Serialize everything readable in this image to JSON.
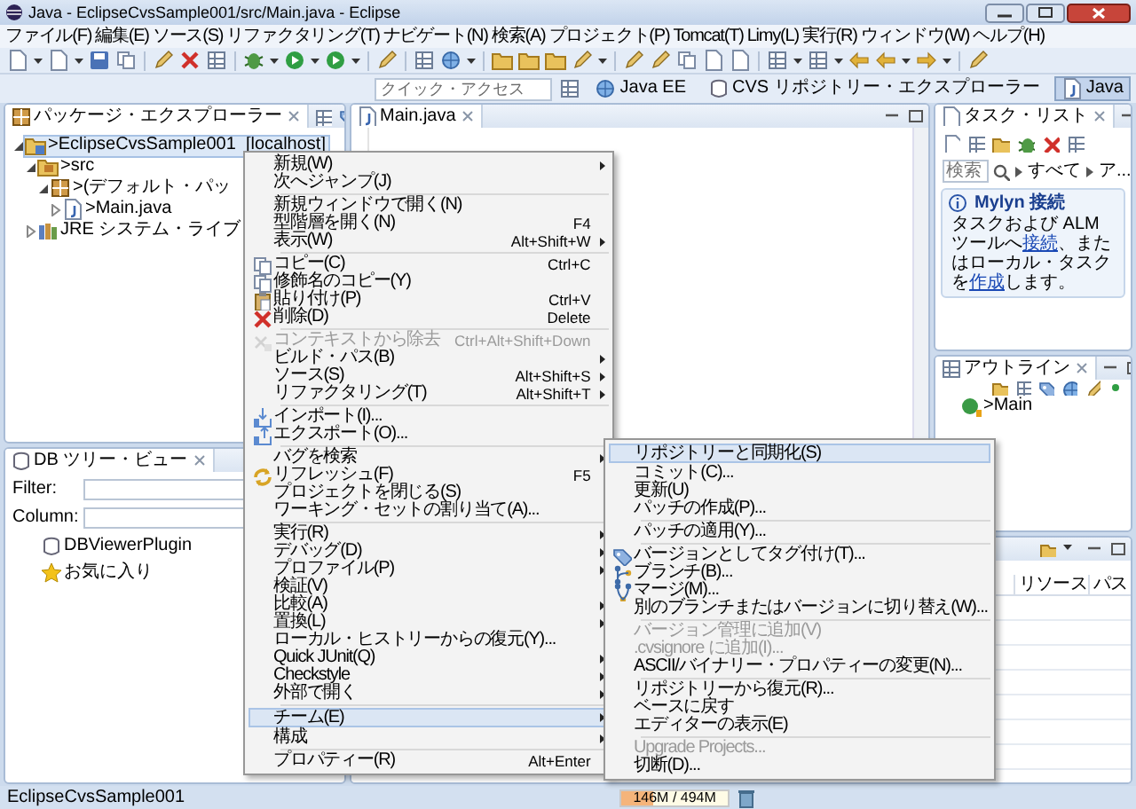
{
  "window": {
    "title": "Java - EclipseCvsSample001/src/Main.java - Eclipse"
  },
  "menu_bar": [
    "ファイル(F)",
    "編集(E)",
    "ソース(S)",
    "リファクタリング(T)",
    "ナビゲート(N)",
    "検索(A)",
    "プロジェクト(P)",
    "Tomcat(T)",
    "Limy(L)",
    "実行(R)",
    "ウィンドウ(W)",
    "ヘルプ(H)"
  ],
  "perspective_bar": {
    "quick_access_placeholder": "クイック・アクセス",
    "perspectives": [
      {
        "label": "Java EE",
        "selected": false
      },
      {
        "label": "CVS リポジトリー・エクスプローラー",
        "selected": false
      },
      {
        "label": "Java",
        "selected": true
      }
    ]
  },
  "package_explorer": {
    "title": "パッケージ・エクスプローラー",
    "tree": [
      {
        "label": ">EclipseCvsSample001  [localhost]",
        "kind": "project",
        "selected": true,
        "expanded": true,
        "children": [
          {
            "label": ">src",
            "kind": "source-folder",
            "selected": false,
            "expanded": true,
            "children": [
              {
                "label": ">(デフォルト・パッ",
                "kind": "package",
                "selected": false,
                "expanded": true,
                "children": [
                  {
                    "label": ">Main.java",
                    "kind": "java-file",
                    "selected": false,
                    "expanded": false
                  }
                ]
              }
            ]
          },
          {
            "label": "JRE システム・ライブ",
            "kind": "library",
            "selected": false,
            "expanded": false
          }
        ]
      }
    ]
  },
  "db_tree_view": {
    "title": "DB ツリー・ビュー",
    "filter_label": "Filter:",
    "column_label": "Column:",
    "items": [
      {
        "label": "DBViewerPlugin",
        "kind": "database"
      },
      {
        "label": "お気に入り",
        "kind": "favorite"
      }
    ]
  },
  "editor": {
    "tab": "Main.java"
  },
  "task_list": {
    "title": "タスク・リスト",
    "search_placeholder": "検索",
    "filters": [
      "すべて",
      "ア..."
    ],
    "mylyn": {
      "title": "Mylyn 接続",
      "segments": [
        {
          "text": "タスクおよび ALM ツールへ",
          "link": false
        },
        {
          "text": "接続",
          "link": true
        },
        {
          "text": "、またはローカル・タスクを",
          "link": false
        },
        {
          "text": "作成",
          "link": true
        },
        {
          "text": "します。",
          "link": false
        }
      ]
    }
  },
  "outline": {
    "title": "アウトライン",
    "items": [
      {
        "label": ">Main"
      }
    ]
  },
  "bottom_panel": {
    "columns": [
      "リソース",
      "パス"
    ]
  },
  "context_menu": {
    "items": [
      {
        "kind": "item",
        "label": "新規(W)",
        "submenu": true,
        "disabled": false,
        "selected": false
      },
      {
        "kind": "item",
        "label": "次へジャンプ(J)",
        "submenu": false,
        "disabled": false,
        "selected": false
      },
      {
        "kind": "separator"
      },
      {
        "kind": "item",
        "label": "新規ウィンドウで開く(N)",
        "submenu": false,
        "disabled": false,
        "selected": false
      },
      {
        "kind": "item",
        "label": "型階層を開く(N)",
        "shortcut": "F4",
        "submenu": false,
        "disabled": false,
        "selected": false
      },
      {
        "kind": "item",
        "label": "表示(W)",
        "shortcut": "Alt+Shift+W",
        "submenu": true,
        "disabled": false,
        "selected": false
      },
      {
        "kind": "separator"
      },
      {
        "kind": "item",
        "label": "コピー(C)",
        "shortcut": "Ctrl+C",
        "submenu": false,
        "disabled": false,
        "selected": false
      },
      {
        "kind": "item",
        "label": "修飾名のコピー(Y)",
        "submenu": false,
        "disabled": false,
        "selected": false
      },
      {
        "kind": "item",
        "label": "貼り付け(P)",
        "shortcut": "Ctrl+V",
        "submenu": false,
        "disabled": false,
        "selected": false
      },
      {
        "kind": "item",
        "label": "削除(D)",
        "shortcut": "Delete",
        "submenu": false,
        "disabled": false,
        "selected": false
      },
      {
        "kind": "separator"
      },
      {
        "kind": "item",
        "label": "コンテキストから除去",
        "shortcut": "Ctrl+Alt+Shift+Down",
        "submenu": false,
        "disabled": true,
        "selected": false
      },
      {
        "kind": "item",
        "label": "ビルド・パス(B)",
        "submenu": true,
        "disabled": false,
        "selected": false
      },
      {
        "kind": "item",
        "label": "ソース(S)",
        "shortcut": "Alt+Shift+S",
        "submenu": true,
        "disabled": false,
        "selected": false
      },
      {
        "kind": "item",
        "label": "リファクタリング(T)",
        "shortcut": "Alt+Shift+T",
        "submenu": true,
        "disabled": false,
        "selected": false
      },
      {
        "kind": "separator"
      },
      {
        "kind": "item",
        "label": "インポート(I)...",
        "submenu": false,
        "disabled": false,
        "selected": false
      },
      {
        "kind": "item",
        "label": "エクスポート(O)...",
        "submenu": false,
        "disabled": false,
        "selected": false
      },
      {
        "kind": "separator"
      },
      {
        "kind": "item",
        "label": "バグを検索",
        "submenu": true,
        "disabled": false,
        "selected": false
      },
      {
        "kind": "item",
        "label": "リフレッシュ(F)",
        "shortcut": "F5",
        "submenu": false,
        "disabled": false,
        "selected": false
      },
      {
        "kind": "item",
        "label": "プロジェクトを閉じる(S)",
        "submenu": false,
        "disabled": false,
        "selected": false
      },
      {
        "kind": "item",
        "label": "ワーキング・セットの割り当て(A)...",
        "submenu": false,
        "disabled": false,
        "selected": false
      },
      {
        "kind": "separator"
      },
      {
        "kind": "item",
        "label": "実行(R)",
        "submenu": true,
        "disabled": false,
        "selected": false
      },
      {
        "kind": "item",
        "label": "デバッグ(D)",
        "submenu": true,
        "disabled": false,
        "selected": false
      },
      {
        "kind": "item",
        "label": "プロファイル(P)",
        "submenu": true,
        "disabled": false,
        "selected": false
      },
      {
        "kind": "item",
        "label": "検証(V)",
        "submenu": false,
        "disabled": false,
        "selected": false
      },
      {
        "kind": "item",
        "label": "比較(A)",
        "submenu": true,
        "disabled": false,
        "selected": false
      },
      {
        "kind": "item",
        "label": "置換(L)",
        "submenu": true,
        "disabled": false,
        "selected": false
      },
      {
        "kind": "item",
        "label": "ローカル・ヒストリーからの復元(Y)...",
        "submenu": false,
        "disabled": false,
        "selected": false
      },
      {
        "kind": "item",
        "label": "Quick JUnit(Q)",
        "submenu": true,
        "disabled": false,
        "selected": false
      },
      {
        "kind": "item",
        "label": "Checkstyle",
        "submenu": true,
        "disabled": false,
        "selected": false
      },
      {
        "kind": "item",
        "label": "外部で開く",
        "submenu": true,
        "disabled": false,
        "selected": false
      },
      {
        "kind": "separator"
      },
      {
        "kind": "item",
        "label": "チーム(E)",
        "submenu": true,
        "disabled": false,
        "selected": true
      },
      {
        "kind": "item",
        "label": "構成",
        "submenu": true,
        "disabled": false,
        "selected": false
      },
      {
        "kind": "separator"
      },
      {
        "kind": "item",
        "label": "プロパティー(R)",
        "shortcut": "Alt+Enter",
        "submenu": false,
        "disabled": false,
        "selected": false
      }
    ]
  },
  "team_submenu": {
    "items": [
      {
        "kind": "item",
        "label": "リポジトリーと同期化(S)",
        "disabled": false,
        "selected": true
      },
      {
        "kind": "item",
        "label": "コミット(C)...",
        "disabled": false,
        "selected": false
      },
      {
        "kind": "item",
        "label": "更新(U)",
        "disabled": false,
        "selected": false
      },
      {
        "kind": "item",
        "label": "パッチの作成(P)...",
        "disabled": false,
        "selected": false
      },
      {
        "kind": "separator"
      },
      {
        "kind": "item",
        "label": "パッチの適用(Y)...",
        "disabled": false,
        "selected": false
      },
      {
        "kind": "separator"
      },
      {
        "kind": "item",
        "label": "バージョンとしてタグ付け(T)...",
        "disabled": false,
        "selected": false
      },
      {
        "kind": "item",
        "label": "ブランチ(B)...",
        "disabled": false,
        "selected": false
      },
      {
        "kind": "item",
        "label": "マージ(M)...",
        "disabled": false,
        "selected": false
      },
      {
        "kind": "item",
        "label": "別のブランチまたはバージョンに切り替え(W)...",
        "disabled": false,
        "selected": false
      },
      {
        "kind": "separator"
      },
      {
        "kind": "item",
        "label": "バージョン管理に追加(V)",
        "disabled": true,
        "selected": false
      },
      {
        "kind": "item",
        "label": ".cvsignore に追加(I)...",
        "disabled": true,
        "selected": false
      },
      {
        "kind": "item",
        "label": "ASCII/バイナリー・プロパティーの変更(N)...",
        "disabled": false,
        "selected": false
      },
      {
        "kind": "separator"
      },
      {
        "kind": "item",
        "label": "リポジトリーから復元(R)...",
        "disabled": false,
        "selected": false
      },
      {
        "kind": "item",
        "label": "ベースに戻す",
        "disabled": false,
        "selected": false
      },
      {
        "kind": "item",
        "label": "エディターの表示(E)",
        "disabled": false,
        "selected": false
      },
      {
        "kind": "separator"
      },
      {
        "kind": "item",
        "label": "Upgrade Projects...",
        "disabled": true,
        "selected": false
      },
      {
        "kind": "item",
        "label": "切断(D)...",
        "disabled": false,
        "selected": false
      }
    ]
  },
  "status_bar": {
    "text": "EclipseCvsSample001",
    "memory": {
      "label": "146M / 494M",
      "level": 0.3
    }
  }
}
